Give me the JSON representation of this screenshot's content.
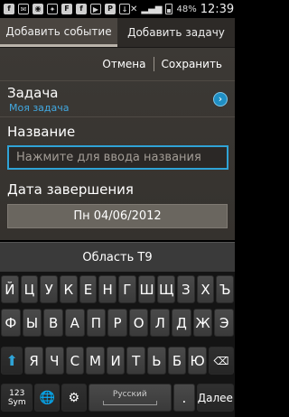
{
  "status_bar": {
    "icons_left": [
      "facebook-icon",
      "mail-icon",
      "instagram-icon",
      "twitter-icon",
      "flipboard-icon",
      "facebook-icon",
      "play-icon",
      "p-icon",
      "download-icon"
    ],
    "icons_right": [
      "mute-icon",
      "signal-icon"
    ],
    "battery_percent": "48%",
    "time": "12:39"
  },
  "tabs": [
    {
      "label": "Добавить событие",
      "active": true
    },
    {
      "label": "Добавить задачу",
      "active": false
    }
  ],
  "actions": {
    "cancel": "Отмена",
    "save": "Сохранить"
  },
  "task": {
    "label": "Задача",
    "value": "Моя задача"
  },
  "name": {
    "label": "Название",
    "placeholder": "Нажмите для ввода названия"
  },
  "due_date": {
    "label": "Дата завершения",
    "value": "Пн 04/06/2012"
  },
  "keyboard": {
    "t9_label": "Область Т9",
    "row1": [
      "Й",
      "Ц",
      "У",
      "К",
      "Е",
      "Н",
      "Г",
      "Ш",
      "Щ",
      "З",
      "Х",
      "Ъ"
    ],
    "row2": [
      "Ф",
      "Ы",
      "В",
      "А",
      "П",
      "Р",
      "О",
      "Л",
      "Д",
      "Ж",
      "Э"
    ],
    "row3": [
      "Я",
      "Ч",
      "С",
      "М",
      "И",
      "Т",
      "Ь",
      "Б",
      "Ю"
    ],
    "sym_top": "123",
    "sym_bottom": "Sym",
    "space_label": "Русский",
    "dot": ".",
    "enter": "Далее"
  }
}
